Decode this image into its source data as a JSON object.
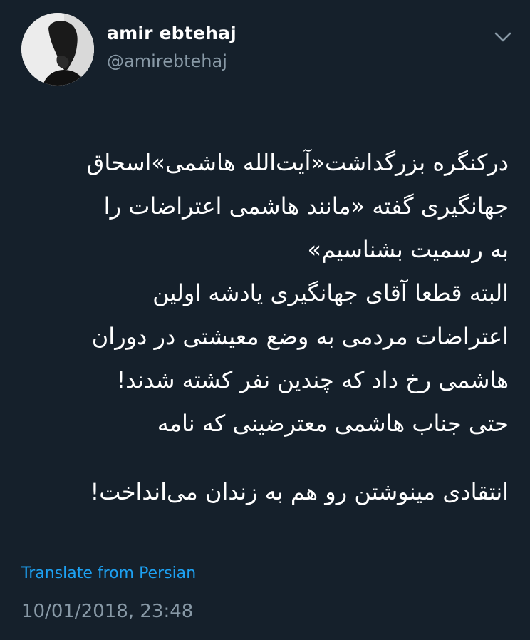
{
  "user": {
    "display_name": "amir ebtehaj",
    "handle": "@amirebtehaj"
  },
  "tweet": {
    "lines": [
      "درکنگره بزرگداشت«آیت‌الله هاشمی»اسحاق",
      "جهانگیری گفته «مانند هاشمی اعتراضات را",
      "به رسمیت بشناسیم»",
      "البته قطعا آقای جهانگیری یادشه اولین",
      "اعتراضات مردمی به وضع معیشتی در دوران",
      "هاشمی رخ داد که چندین نفر کشته شدند!",
      "حتی جناب هاشمی معترضینی که نامه",
      "انتقادی مینوشتن رو هم به زندان می‌انداخت!"
    ]
  },
  "translate_label": "Translate from Persian",
  "timestamp": "10/01/2018, 23:48",
  "icons": {
    "menu": "chevron-down-icon"
  },
  "colors": {
    "background": "#15202b",
    "primary_text": "#ffffff",
    "secondary_text": "#8899a6",
    "link": "#1da1f2"
  }
}
